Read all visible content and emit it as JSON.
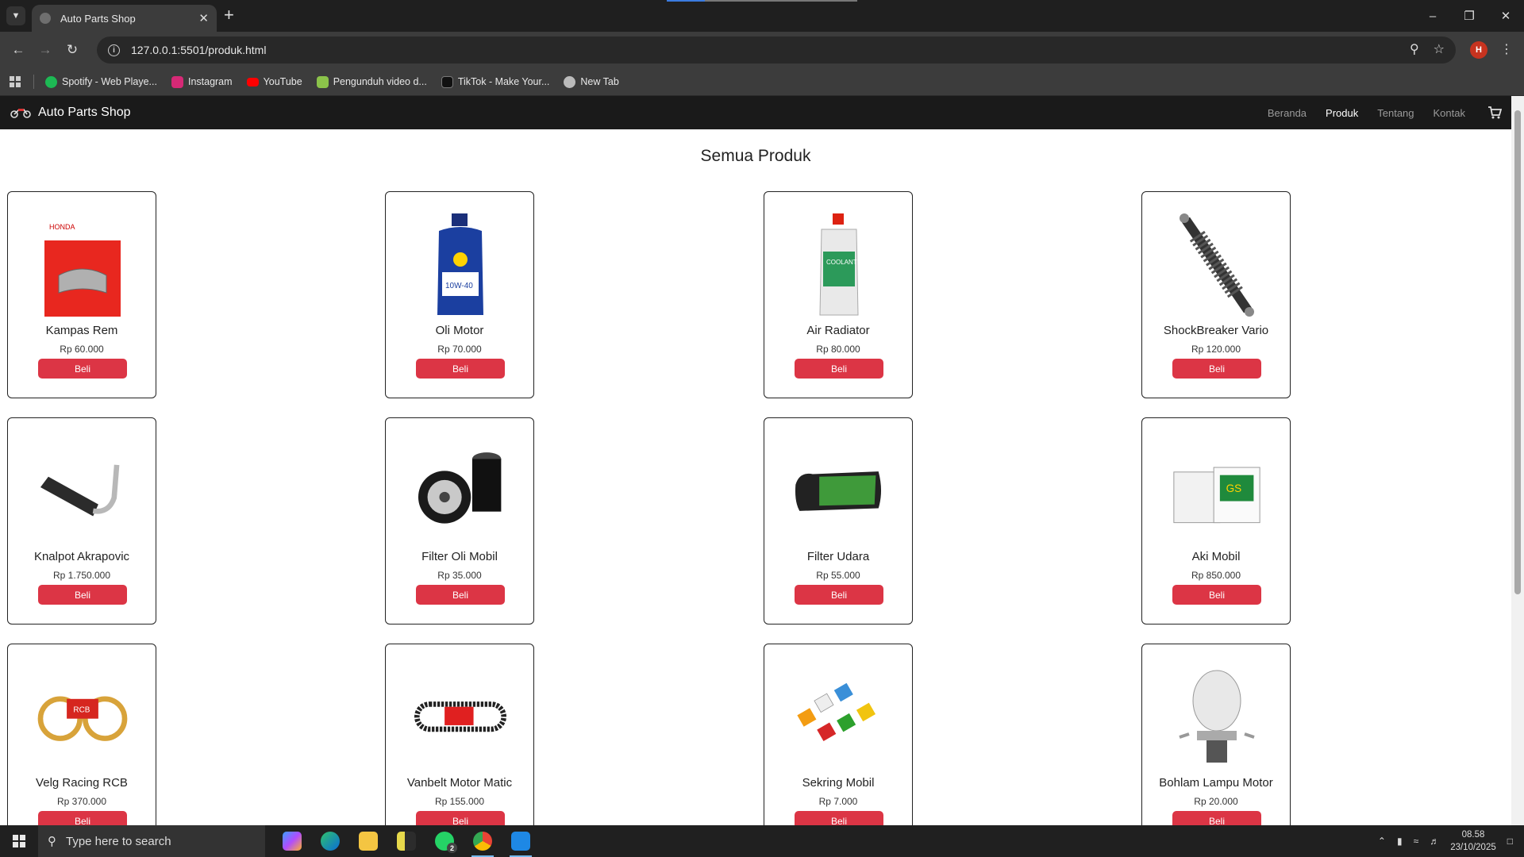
{
  "browser": {
    "tab_title": "Auto Parts Shop",
    "new_tab": "+",
    "address": "127.0.0.1:5501/produk.html",
    "profile_initial": "H",
    "bookmarks": [
      {
        "label": "Spotify - Web Playe...",
        "icon": "spotify-icon",
        "color": "#1db954"
      },
      {
        "label": "Instagram",
        "icon": "instagram-icon",
        "color": "#d62976"
      },
      {
        "label": "YouTube",
        "icon": "youtube-icon",
        "color": "#ff0000"
      },
      {
        "label": "Pengunduh video d...",
        "icon": "download-icon",
        "color": "#8bc34a"
      },
      {
        "label": "TikTok - Make Your...",
        "icon": "tiktok-icon",
        "color": "#111111"
      },
      {
        "label": "New Tab",
        "icon": "globe-icon",
        "color": "#bbbbbb"
      }
    ]
  },
  "site": {
    "brand": "Auto Parts Shop",
    "nav": [
      "Beranda",
      "Produk",
      "Tentang",
      "Kontak"
    ],
    "active_nav": "Produk",
    "page_title": "Semua Produk",
    "buy_label": "Beli",
    "accent_color": "#dc3545",
    "products": [
      {
        "name": "Kampas Rem",
        "price": "Rp 60.000",
        "image": "brake-pad-image"
      },
      {
        "name": "Oli Motor",
        "price": "Rp 70.000",
        "image": "motor-oil-image"
      },
      {
        "name": "Air Radiator",
        "price": "Rp 80.000",
        "image": "coolant-image"
      },
      {
        "name": "ShockBreaker Vario",
        "price": "Rp 120.000",
        "image": "shock-absorber-image"
      },
      {
        "name": "Knalpot Akrapovic",
        "price": "Rp 1.750.000",
        "image": "exhaust-image"
      },
      {
        "name": "Filter Oli Mobil",
        "price": "Rp 35.000",
        "image": "oil-filter-image"
      },
      {
        "name": "Filter Udara",
        "price": "Rp 55.000",
        "image": "air-filter-image"
      },
      {
        "name": "Aki Mobil",
        "price": "Rp 850.000",
        "image": "car-battery-image"
      },
      {
        "name": "Velg Racing RCB",
        "price": "Rp 370.000",
        "image": "racing-wheel-image"
      },
      {
        "name": "Vanbelt Motor Matic",
        "price": "Rp 155.000",
        "image": "v-belt-image"
      },
      {
        "name": "Sekring Mobil",
        "price": "Rp 7.000",
        "image": "fuse-image"
      },
      {
        "name": "Bohlam Lampu Motor",
        "price": "Rp 20.000",
        "image": "headlight-bulb-image"
      }
    ]
  },
  "taskbar": {
    "search_placeholder": "Type here to search",
    "time": "08.58",
    "date": "23/10/2025",
    "whatsapp_badge": "2"
  }
}
